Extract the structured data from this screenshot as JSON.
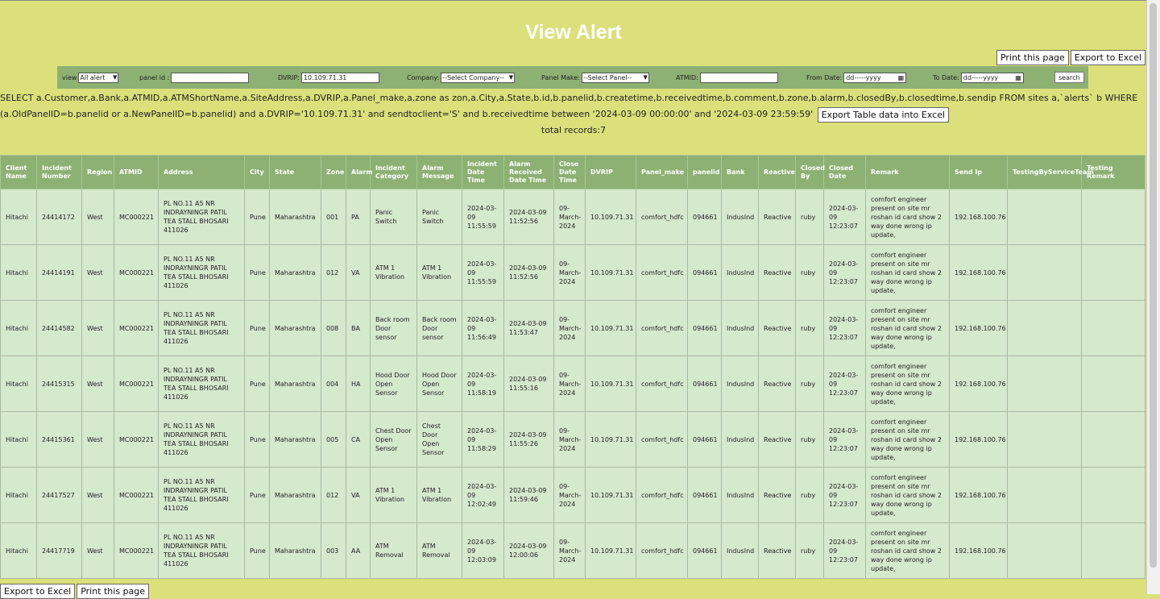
{
  "title": "View Alert",
  "top_actions": {
    "print": "Print this page",
    "export": "Export to Excel"
  },
  "filters": {
    "view_label": "view",
    "view_value": "All alert",
    "panel_label": "panel id :",
    "panel_value": "",
    "dvrip_label": "DVRIP:",
    "dvrip_value": "10.109.71.31",
    "company_label": "Company:",
    "company_value": "--Select Company--",
    "panel_make_label": "Panel Make:",
    "panel_make_value": "--Select Panel--",
    "atmid_label": "ATMID:",
    "atmid_value": "",
    "from_label": "From Date:",
    "from_value": "dd-----yyyy",
    "to_label": "To Date:",
    "to_value": "dd-----yyyy",
    "search_label": "search"
  },
  "query_text": "SELECT a.Customer,a.Bank,a.ATMID,a.ATMShortName,a.SiteAddress,a.DVRIP,a.Panel_make,a.zone as zon,a.City,a.State,b.id,b.panelid,b.createtime,b.receivedtime,b.comment,b.zone,b.alarm,b.closedBy,b.closedtime,b.sendip FROM sites a,`alerts` b WHERE (a.OldPanelID=b.panelid or a.NewPanelID=b.panelid) and a.DVRIP='10.109.71.31' and sendtoclient='S' and b.receivedtime between '2024-03-09 00:00:00' and '2024-03-09 23:59:59'",
  "export_table_label": "Export Table data into Excel",
  "total_records": "total records:7",
  "columns": [
    "Client Name",
    "Incident Number",
    "Region",
    "ATMID",
    "Address",
    "City",
    "State",
    "Zone",
    "Alarm",
    "Incident Category",
    "Alarm Message",
    "Incident Date Time",
    "Alarm Received Date Time",
    "Close Date Time",
    "DVRIP",
    "Panel_make",
    "panelid",
    "Bank",
    "Reactive",
    "Closed By",
    "Closed Date",
    "Remark",
    "Send Ip",
    "TestingByServiceTeam",
    "Testing Remark"
  ],
  "rows": [
    [
      "Hitachi",
      "24414172",
      "West",
      "MC000221",
      "PL NO.11 A5 NR INDRAYNINGR PATIL TEA STALL BHOSARI 411026",
      "Pune",
      "Maharashtra",
      "001",
      "PA",
      "Panic Switch",
      "Panic Switch",
      "2024-03-09 11:55:59",
      "2024-03-09 11:52:56",
      "09-March-2024",
      "10.109.71.31",
      "comfort_hdfc",
      "094661",
      "IndusInd",
      "Reactive",
      "ruby",
      "2024-03-09 12:23:07",
      "comfort engineer present on site mr roshan id card show 2 way done wrong ip update,",
      "192.168.100.76",
      "",
      ""
    ],
    [
      "Hitachi",
      "24414191",
      "West",
      "MC000221",
      "PL NO.11 A5 NR INDRAYNINGR PATIL TEA STALL BHOSARI 411026",
      "Pune",
      "Maharashtra",
      "012",
      "VA",
      "ATM 1 Vibration",
      "ATM 1 Vibration",
      "2024-03-09 11:55:59",
      "2024-03-09 11:52:56",
      "09-March-2024",
      "10.109.71.31",
      "comfort_hdfc",
      "094661",
      "IndusInd",
      "Reactive",
      "ruby",
      "2024-03-09 12:23:07",
      "comfort engineer present on site mr roshan id card show 2 way done wrong ip update,",
      "192.168.100.76",
      "",
      ""
    ],
    [
      "Hitachi",
      "24414582",
      "West",
      "MC000221",
      "PL NO.11 A5 NR INDRAYNINGR PATIL TEA STALL BHOSARI 411026",
      "Pune",
      "Maharashtra",
      "008",
      "BA",
      "Back room Door sensor",
      "Back room Door sensor",
      "2024-03-09 11:56:49",
      "2024-03-09 11:53:47",
      "09-March-2024",
      "10.109.71.31",
      "comfort_hdfc",
      "094661",
      "IndusInd",
      "Reactive",
      "ruby",
      "2024-03-09 12:23:07",
      "comfort engineer present on site mr roshan id card show 2 way done wrong ip update,",
      "192.168.100.76",
      "",
      ""
    ],
    [
      "Hitachi",
      "24415315",
      "West",
      "MC000221",
      "PL NO.11 A5 NR INDRAYNINGR PATIL TEA STALL BHOSARI 411026",
      "Pune",
      "Maharashtra",
      "004",
      "HA",
      "Hood Door Open Sensor",
      "Hood Door Open Sensor",
      "2024-03-09 11:58:19",
      "2024-03-09 11:55:16",
      "09-March-2024",
      "10.109.71.31",
      "comfort_hdfc",
      "094661",
      "IndusInd",
      "Reactive",
      "ruby",
      "2024-03-09 12:23:07",
      "comfort engineer present on site mr roshan id card show 2 way done wrong ip update,",
      "192.168.100.76",
      "",
      ""
    ],
    [
      "Hitachi",
      "24415361",
      "West",
      "MC000221",
      "PL NO.11 A5 NR INDRAYNINGR PATIL TEA STALL BHOSARI 411026",
      "Pune",
      "Maharashtra",
      "005",
      "CA",
      "Chest Door Open Sensor",
      "Chest Door Open Sensor",
      "2024-03-09 11:58:29",
      "2024-03-09 11:55:26",
      "09-March-2024",
      "10.109.71.31",
      "comfort_hdfc",
      "094661",
      "IndusInd",
      "Reactive",
      "ruby",
      "2024-03-09 12:23:07",
      "comfort engineer present on site mr roshan id card show 2 way done wrong ip update,",
      "192.168.100.76",
      "",
      ""
    ],
    [
      "Hitachi",
      "24417527",
      "West",
      "MC000221",
      "PL NO.11 A5 NR INDRAYNINGR PATIL TEA STALL BHOSARI 411026",
      "Pune",
      "Maharashtra",
      "012",
      "VA",
      "ATM 1 Vibration",
      "ATM 1 Vibration",
      "2024-03-09 12:02:49",
      "2024-03-09 11:59:46",
      "09-March-2024",
      "10.109.71.31",
      "comfort_hdfc",
      "094661",
      "IndusInd",
      "Reactive",
      "ruby",
      "2024-03-09 12:23:07",
      "comfort engineer present on site mr roshan id card show 2 way done wrong ip update,",
      "192.168.100.76",
      "",
      ""
    ],
    [
      "Hitachi",
      "24417719",
      "West",
      "MC000221",
      "PL NO.11 A5 NR INDRAYNINGR PATIL TEA STALL BHOSARI 411026",
      "Pune",
      "Maharashtra",
      "003",
      "AA",
      "ATM Removal",
      "ATM Removal",
      "2024-03-09 12:03:09",
      "2024-03-09 12:00:06",
      "09-March-2024",
      "10.109.71.31",
      "comfort_hdfc",
      "094661",
      "IndusInd",
      "Reactive",
      "ruby",
      "2024-03-09 12:23:07",
      "comfort engineer present on site mr roshan id card show 2 way done wrong ip update,",
      "192.168.100.76",
      "",
      ""
    ]
  ],
  "bottom_actions": {
    "export": "Export to Excel",
    "print": "Print this page"
  }
}
